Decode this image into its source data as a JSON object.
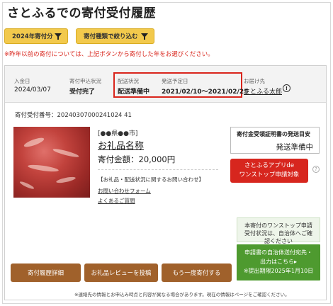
{
  "page": {
    "title": "さとふるでの寄付受付履歴"
  },
  "filters": {
    "year_label": "2024年寄付分",
    "type_label": "寄付種類で絞り込む",
    "notice": "※昨年以前の寄付については、上記ボタンから寄付した年をお選びください。"
  },
  "donation": {
    "received_date_label": "入金日",
    "received_date": "2024/03/07",
    "application_status_label": "寄付申込状況",
    "application_status": "受付完了",
    "shipping_status_label": "配送状況",
    "shipping_status": "配送準備中",
    "expected_date_label": "発送予定日",
    "expected_date": "2021/02/10〜2021/02/25",
    "recipient_label": "お届け先",
    "recipient": "さとふる太郎",
    "receipt_no": "寄付受付番号：20240307000241024 41",
    "prefecture": "[●●県●●市]",
    "product_name": "お礼品名称",
    "amount": "寄付金額：20,000円",
    "inquiry_note": "【お礼品・配送状況に関するお問い合わせ】",
    "inquiry_form": "お問い合わせフォーム",
    "faq": "よくあるご質問"
  },
  "certificate": {
    "title": "寄付金受領証明書の発送目安",
    "status": "発送準備中"
  },
  "app_badge": {
    "line1": "さとふるアプリde",
    "line2": "ワンストップ申請対象"
  },
  "onestop": {
    "line1": "本寄付のワンストップ申請",
    "line2": "受付状況は、自治体へご確",
    "line3": "認ください"
  },
  "submit": {
    "line1": "申請書の自治体送付宛先・",
    "line2": "出力はこちら▸",
    "line3": "※提出期限2025年1月10日"
  },
  "buttons": {
    "history": "寄付履歴詳細",
    "review": "お礼品レビューを投稿",
    "again": "もう一度寄付する"
  },
  "footnote": "※連絡先の情報とお申込み時点と内容が異なる場合があります。現在の情報はページをご確認ください。",
  "colors": {
    "accent_yellow": "#f2c94c",
    "brown": "#a0612b",
    "red": "#d7261e",
    "green": "#4e9a2f"
  }
}
